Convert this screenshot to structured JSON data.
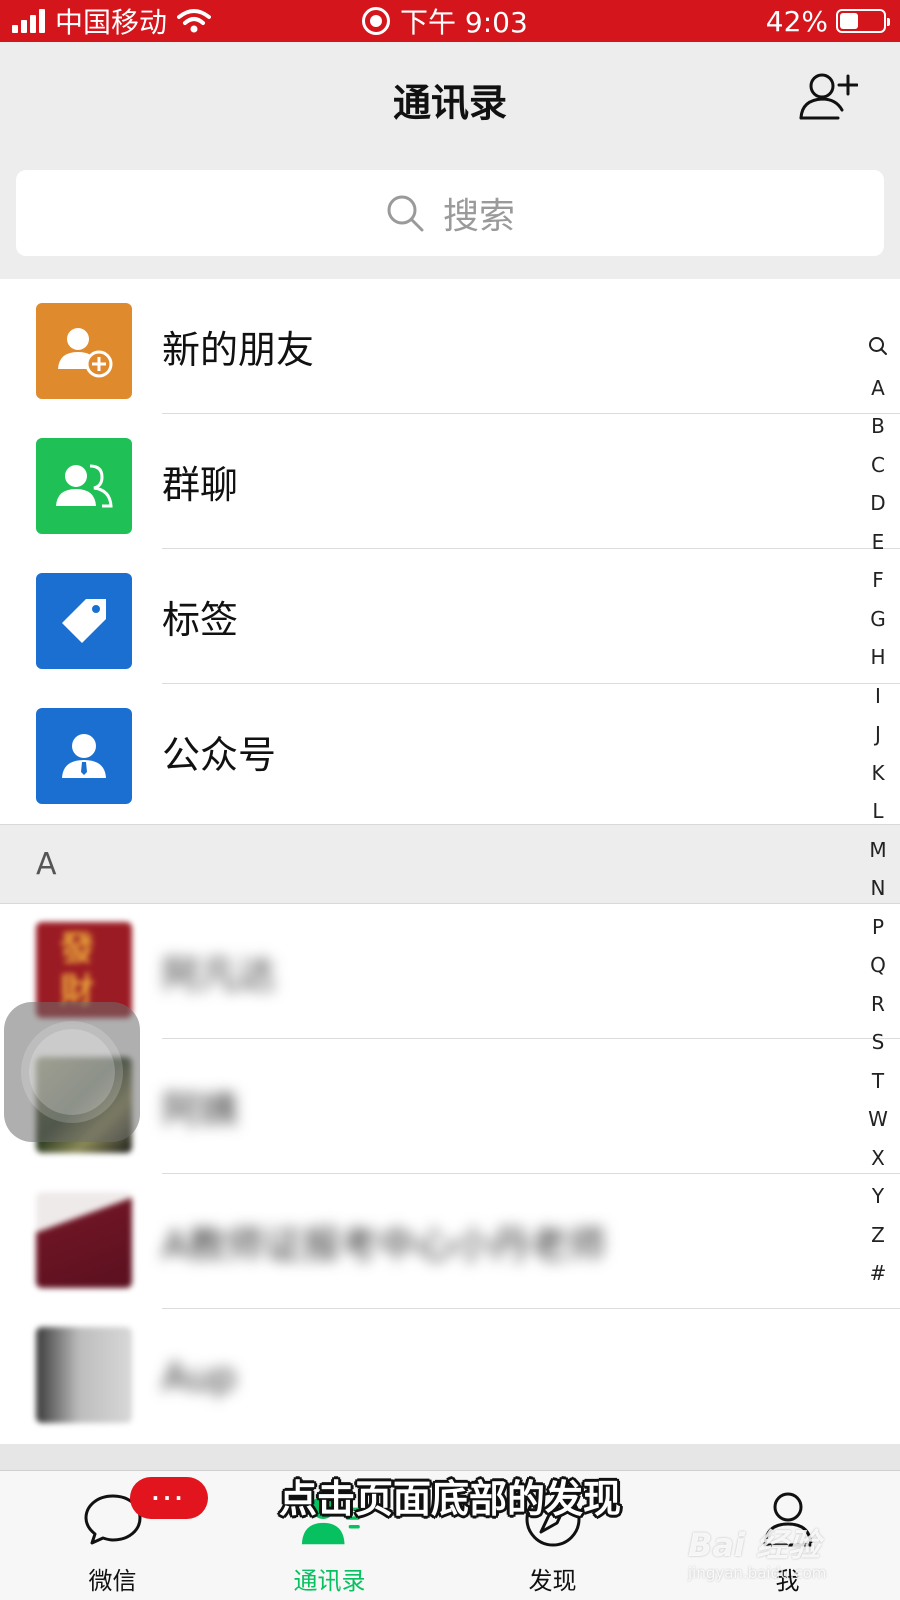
{
  "status_bar": {
    "carrier": "中国移动",
    "time": "下午 9:03",
    "battery": "42%",
    "battery_level": 0.42
  },
  "header": {
    "title": "通讯录",
    "add_friend_icon": "add-user-icon"
  },
  "search": {
    "placeholder": "搜索"
  },
  "functions": [
    {
      "label": "新的朋友",
      "icon": "new-friend-icon",
      "color": "#e08a2e"
    },
    {
      "label": "群聊",
      "icon": "group-chat-icon",
      "color": "#1fc156"
    },
    {
      "label": "标签",
      "icon": "tag-icon",
      "color": "#1a6fd1"
    },
    {
      "label": "公众号",
      "icon": "official-account-icon",
      "color": "#1a6fd1"
    }
  ],
  "section_header": "A",
  "contacts": [
    {
      "name": "阿凡达",
      "avatar_text": "發財"
    },
    {
      "name": "阿姨"
    },
    {
      "name": "A教师证报考中心小丹老师"
    },
    {
      "name": "Aup"
    }
  ],
  "index_letters": [
    "Q",
    "A",
    "B",
    "C",
    "D",
    "E",
    "F",
    "G",
    "H",
    "I",
    "J",
    "K",
    "L",
    "M",
    "N",
    "P",
    "Q",
    "R",
    "S",
    "T",
    "W",
    "X",
    "Y",
    "Z",
    "#"
  ],
  "tabs": [
    {
      "label": "微信",
      "icon": "chat-icon",
      "active": false
    },
    {
      "label": "通讯录",
      "icon": "contacts-icon",
      "active": true
    },
    {
      "label": "发现",
      "icon": "compass-icon",
      "active": false
    },
    {
      "label": "我",
      "icon": "me-icon",
      "active": false
    }
  ],
  "badge": "···",
  "caption": "点击页面底部的发现",
  "watermark": {
    "main": "Bai 经验",
    "sub": "jingyan.baidu.com"
  },
  "colors": {
    "status_bar": "#d4151c",
    "accent_green": "#07c160",
    "header_bg": "#ededed"
  }
}
